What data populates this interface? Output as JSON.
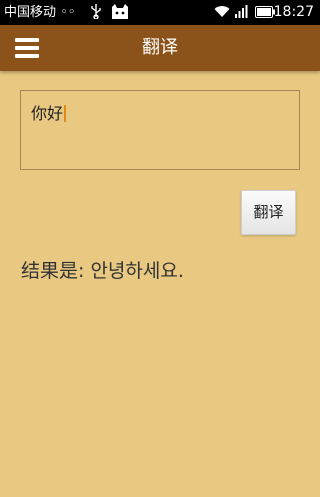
{
  "status_bar": {
    "carrier": "中国移动 ◦◦",
    "time": "18:27",
    "icons": [
      "usb-icon",
      "cat-notification-icon",
      "wifi-icon",
      "signal-icon",
      "battery-icon"
    ]
  },
  "action_bar": {
    "title": "翻译",
    "menu_icon": "hamburger-menu-icon",
    "background": "#8b531a"
  },
  "input": {
    "value": "你好"
  },
  "translate_button": {
    "label": "翻译"
  },
  "result": {
    "text": "结果是:  안녕하세요."
  },
  "colors": {
    "page_background": "#e9c882",
    "caret": "#e08a1a"
  }
}
